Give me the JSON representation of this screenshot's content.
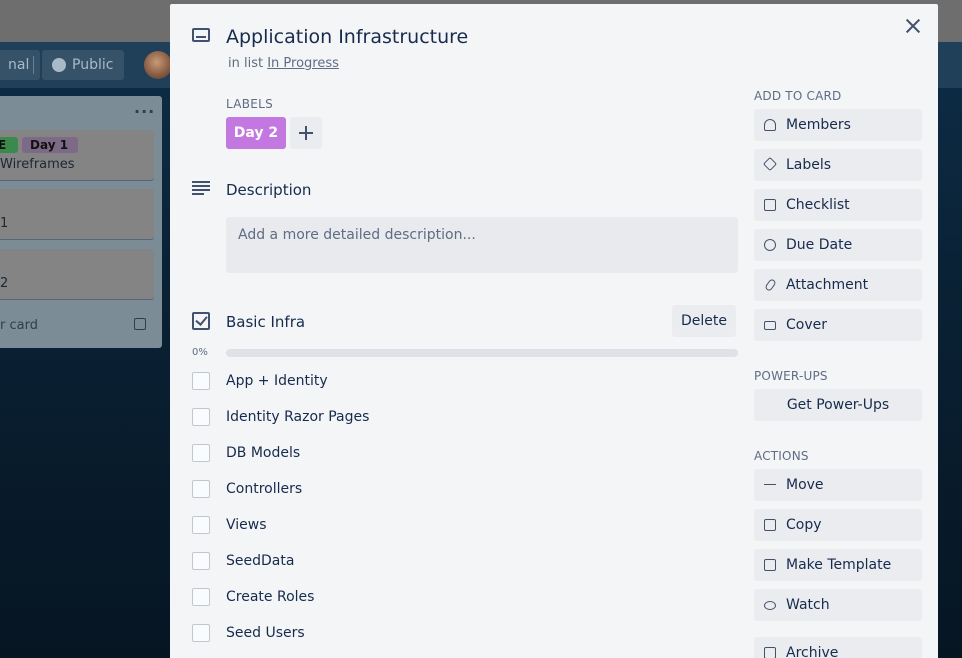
{
  "board": {
    "header": {
      "left_btn_label": "nal",
      "public_label": "Public"
    },
    "list": {
      "menu": "...",
      "cards": [
        {
          "labels": [
            "E",
            "Day 1"
          ],
          "text": "Wireframes"
        },
        {
          "text": "1"
        },
        {
          "text": "2"
        }
      ],
      "add_card_label": "r card"
    }
  },
  "modal": {
    "title": "Application Infrastructure",
    "in_list_prefix": "in list",
    "in_list_name": "In Progress",
    "labels_heading": "LABELS",
    "labels": [
      {
        "name": "Day 2",
        "color": "#c377e0"
      }
    ],
    "description": {
      "heading": "Description",
      "placeholder": "Add a more detailed description..."
    },
    "checklist": {
      "title": "Basic Infra",
      "delete_label": "Delete",
      "percent_label": "0%",
      "progress": 0,
      "items": [
        {
          "text": "App + Identity",
          "checked": false
        },
        {
          "text": "Identity Razor Pages",
          "checked": false
        },
        {
          "text": "DB Models",
          "checked": false
        },
        {
          "text": "Controllers",
          "checked": false
        },
        {
          "text": "Views",
          "checked": false
        },
        {
          "text": "SeedData",
          "checked": false
        },
        {
          "text": "Create Roles",
          "checked": false
        },
        {
          "text": "Seed Users",
          "checked": false
        }
      ]
    },
    "sidebar": {
      "add_to_card_heading": "ADD TO CARD",
      "add_to_card": [
        {
          "label": "Members",
          "icon": "person-icon"
        },
        {
          "label": "Labels",
          "icon": "tag-icon"
        },
        {
          "label": "Checklist",
          "icon": "checkbox-icon"
        },
        {
          "label": "Due Date",
          "icon": "clock-icon"
        },
        {
          "label": "Attachment",
          "icon": "paperclip-icon"
        },
        {
          "label": "Cover",
          "icon": "cover-icon"
        }
      ],
      "power_ups_heading": "POWER-UPS",
      "power_ups_button": "Get Power-Ups",
      "actions_heading": "ACTIONS",
      "actions": [
        {
          "label": "Move",
          "icon": "arrow-right-icon"
        },
        {
          "label": "Copy",
          "icon": "copy-icon"
        },
        {
          "label": "Make Template",
          "icon": "template-icon"
        },
        {
          "label": "Watch",
          "icon": "eye-icon"
        },
        {
          "label": "Archive",
          "icon": "archive-icon"
        }
      ]
    }
  }
}
